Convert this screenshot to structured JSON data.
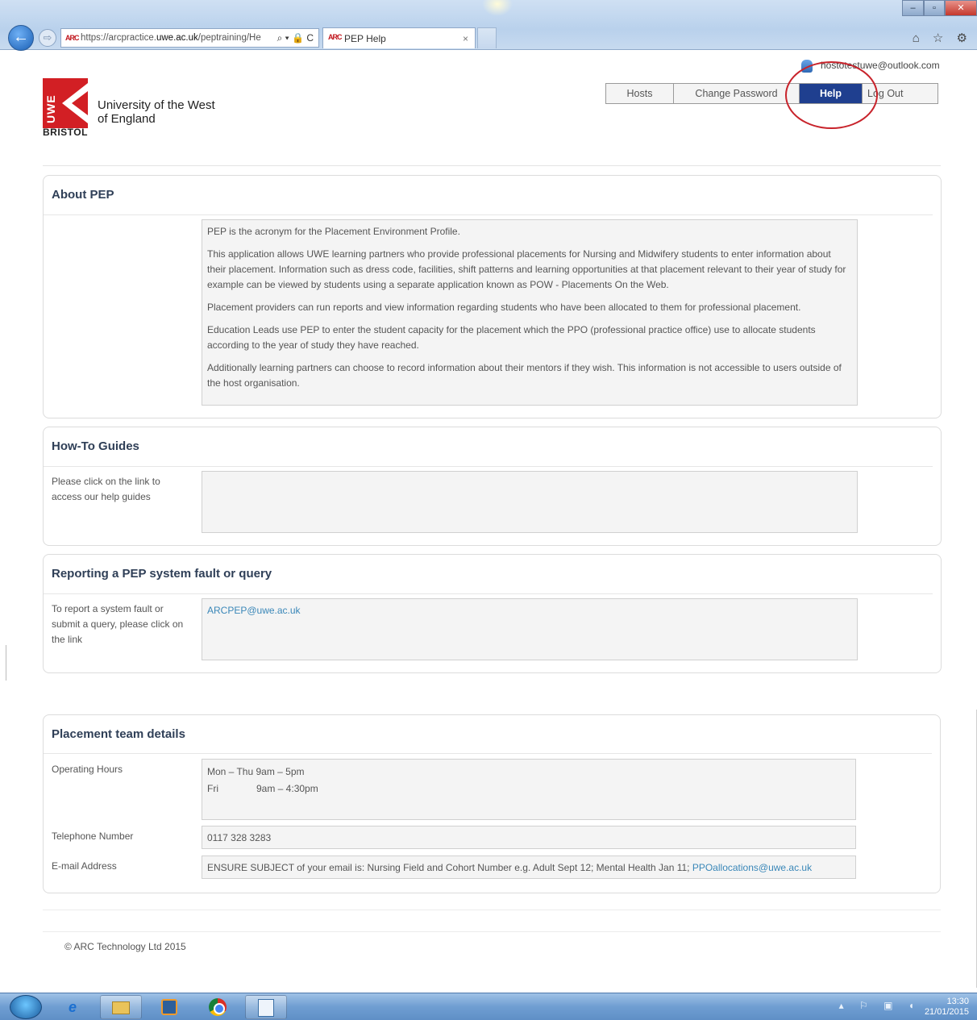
{
  "browser": {
    "url_prefix": "https://arcpractice.",
    "url_domain": "uwe.ac.uk",
    "url_path": "/peptraining/He",
    "address_tools": "⌕ ▾ 🔒 C",
    "tab_title": "PEP Help",
    "tab_close": "×",
    "favorites": "⌂ ☆ ⚙",
    "back_glyph": "←",
    "fwd_glyph": "⇨",
    "logo_text": "ARC"
  },
  "header": {
    "user_email": "hostotestuwe@outlook.com",
    "logo_brand": "UWE",
    "logo_name": "University of the West of England",
    "logo_city": "BRISTOL",
    "nav": {
      "hosts": "Hosts",
      "change_password": "Change Password",
      "help": "Help",
      "log_out": "Log Out"
    }
  },
  "about": {
    "title": "About PEP",
    "paragraphs": [
      "PEP is the acronym for the Placement Environment Profile.",
      "This application allows UWE learning partners who provide professional placements for Nursing and Midwifery students to enter information about their placement. Information such as dress code, facilities, shift patterns and learning opportunities at that placement relevant to their year of study for example can be viewed by students using a separate application known as POW - Placements On the Web.",
      "Placement providers can run reports and view information regarding students who have been allocated to them for professional placement.",
      "Education Leads use PEP to enter the student capacity for the placement which the PPO (professional practice office) use to allocate students according to the year of study they have reached.",
      "Additionally learning partners can choose to record information about their mentors if they wish. This information is not accessible to users outside of the host organisation."
    ]
  },
  "guides": {
    "title": "How-To Guides",
    "label": "Please click on the link to access our help guides"
  },
  "fault": {
    "title": "Reporting a PEP system fault or query",
    "label": "To report a system fault or submit a query, please click on the link",
    "email": "ARCPEP@uwe.ac.uk"
  },
  "placement": {
    "title": "Placement team details",
    "hours_label": "Operating Hours",
    "hours_line1_days": "Mon – Thu",
    "hours_line1_time": "9am – 5pm",
    "hours_line2_days": "Fri",
    "hours_line2_time": "9am – 4:30pm",
    "phone_label": "Telephone Number",
    "phone_value": "0117 328 3283",
    "email_label": "E-mail Address",
    "email_note": "ENSURE SUBJECT of your email is: Nursing Field and Cohort Number e.g. Adult Sept 12; Mental Health Jan 11;",
    "email_link": "PPOallocations@uwe.ac.uk"
  },
  "footer": {
    "copyright": "© ARC Technology Ltd 2015"
  },
  "taskbar": {
    "time": "13:30",
    "date": "21/01/2015",
    "tray": "▴ ⚐ ▣ ◖"
  },
  "colors": {
    "nav_active": "#1f3f8f",
    "heading": "#2f3f57",
    "link": "#3a87b8",
    "highlight_circle": "#c8232b",
    "brand_red": "#d21f24"
  }
}
